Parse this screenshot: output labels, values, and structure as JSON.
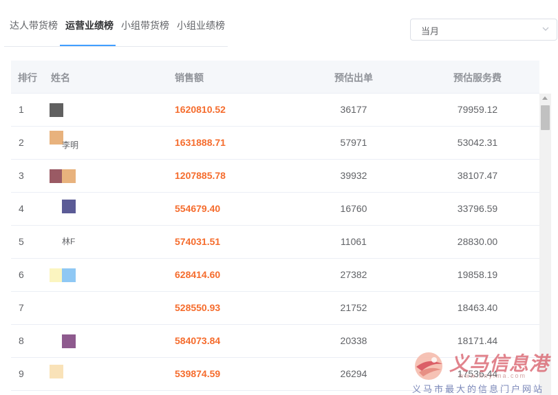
{
  "tabs": [
    {
      "label": "达人带货榜",
      "active": false
    },
    {
      "label": "运营业绩榜",
      "active": true
    },
    {
      "label": "小组带货榜",
      "active": false
    },
    {
      "label": "小组业绩榜",
      "active": false
    }
  ],
  "period_select": {
    "value": "当月",
    "icon": "chevron-down-icon"
  },
  "table": {
    "headers": {
      "rank": "排行",
      "name": "姓名",
      "sales": "销售额",
      "orders": "预估出单",
      "fee": "预估服务费"
    },
    "rows": [
      {
        "rank": "1",
        "sales": "1620810.52",
        "orders": "36177",
        "fee": "79959.12",
        "name_fragment": "",
        "avatar_colors": [
          "#606060"
        ]
      },
      {
        "rank": "2",
        "sales": "1631888.71",
        "orders": "57971",
        "fee": "53042.31",
        "name_fragment": "李明",
        "avatar_colors": [
          "#e8b27d"
        ]
      },
      {
        "rank": "3",
        "sales": "1207885.78",
        "orders": "39932",
        "fee": "38107.47",
        "name_fragment": "",
        "avatar_colors": [
          "#9a5a64",
          "#e8b27d"
        ]
      },
      {
        "rank": "4",
        "sales": "554679.40",
        "orders": "16760",
        "fee": "33796.59",
        "name_fragment": "",
        "avatar_colors": [
          "#5b5b96"
        ]
      },
      {
        "rank": "5",
        "sales": "574031.51",
        "orders": "11061",
        "fee": "28830.00",
        "name_fragment": "林F",
        "avatar_colors": []
      },
      {
        "rank": "6",
        "sales": "628414.60",
        "orders": "27382",
        "fee": "19858.19",
        "name_fragment": "",
        "avatar_colors": [
          "#fbf5c0",
          "#8fc8f4"
        ]
      },
      {
        "rank": "7",
        "sales": "528550.93",
        "orders": "21752",
        "fee": "18463.40",
        "name_fragment": "",
        "avatar_colors": []
      },
      {
        "rank": "8",
        "sales": "584073.84",
        "orders": "20338",
        "fee": "18171.44",
        "name_fragment": "",
        "avatar_colors": [
          "#8e5a8e"
        ]
      },
      {
        "rank": "9",
        "sales": "539874.59",
        "orders": "26294",
        "fee": "17536.44",
        "name_fragment": "",
        "avatar_colors": [
          "#f9e2b8"
        ]
      }
    ]
  },
  "watermark": {
    "title": "义马信息港",
    "url": "www.hnyima.com",
    "tagline": "义马市最大的信息门户网站"
  },
  "colors": {
    "accent": "#409eff",
    "sales_text": "#f56c2d",
    "header_bg": "#f5f7fa",
    "border": "#ebeef5"
  }
}
